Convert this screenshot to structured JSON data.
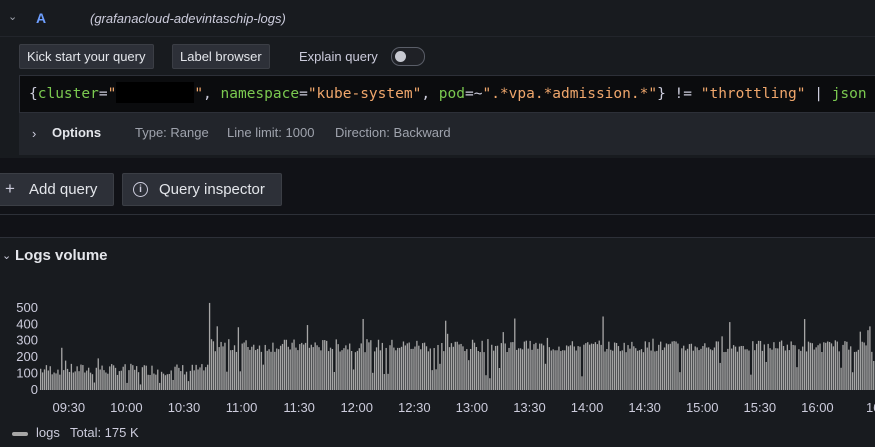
{
  "query_row": {
    "collapse_icon": "chevron-down-icon",
    "ref_id": "A",
    "datasource": "(grafanacloud-adevintaschip-logs)"
  },
  "toolbar": {
    "kick_start_label": "Kick start your query",
    "label_browser_label": "Label browser",
    "explain_query_label": "Explain query",
    "explain_query_on": false
  },
  "editor": {
    "tokens": [
      {
        "text": "{",
        "kind": "brace"
      },
      {
        "text": "cluster",
        "kind": "label"
      },
      {
        "text": "=",
        "kind": "op"
      },
      {
        "text": "\"",
        "kind": "str"
      },
      {
        "text": "",
        "kind": "redacted"
      },
      {
        "text": "\"",
        "kind": "str"
      },
      {
        "text": ", ",
        "kind": "op"
      },
      {
        "text": "namespace",
        "kind": "label"
      },
      {
        "text": "=",
        "kind": "op"
      },
      {
        "text": "\"kube-system\"",
        "kind": "str"
      },
      {
        "text": ", ",
        "kind": "op"
      },
      {
        "text": "pod",
        "kind": "label"
      },
      {
        "text": "=~",
        "kind": "op"
      },
      {
        "text": "\".*vpa.*admission.*\"",
        "kind": "str"
      },
      {
        "text": "} != ",
        "kind": "op"
      },
      {
        "text": "\"throttling\"",
        "kind": "str"
      },
      {
        "text": " | ",
        "kind": "op"
      },
      {
        "text": "json",
        "kind": "fn"
      }
    ]
  },
  "options": {
    "title": "Options",
    "type": "Type: Range",
    "line_limit": "Line limit: 1000",
    "direction": "Direction: Backward"
  },
  "actions": {
    "add_query": "Add query",
    "query_inspector": "Query inspector"
  },
  "logs_volume": {
    "title": "Logs volume",
    "legend_name": "logs",
    "legend_total": "Total: 175 K"
  },
  "chart_data": {
    "type": "bar",
    "title": "Logs volume",
    "series_color": "#a6a6a6",
    "y_ticks": [
      0,
      100,
      200,
      300,
      400,
      500
    ],
    "ylim": [
      0,
      560
    ],
    "x_ticks": [
      "09:30",
      "10:00",
      "10:30",
      "11:00",
      "11:30",
      "12:00",
      "12:30",
      "13:00",
      "13:30",
      "14:00",
      "14:30",
      "15:00",
      "15:30",
      "16:00",
      "16:"
    ],
    "x_range": [
      "09:15",
      "16:30"
    ],
    "bin_minutes": 1,
    "series": [
      {
        "name": "logs",
        "segments": [
          {
            "from": "09:15",
            "to": "10:43",
            "typical_range": [
              90,
              160
            ],
            "peak": 260
          },
          {
            "from": "10:43",
            "to": "10:44",
            "value": 530
          },
          {
            "from": "10:44",
            "to": "13:25",
            "typical_range": [
              230,
              310
            ],
            "peak": 450
          },
          {
            "from": "13:25",
            "to": "16:30",
            "typical_range": [
              230,
              300
            ],
            "peak": 450
          }
        ]
      }
    ],
    "total": "175 K"
  }
}
